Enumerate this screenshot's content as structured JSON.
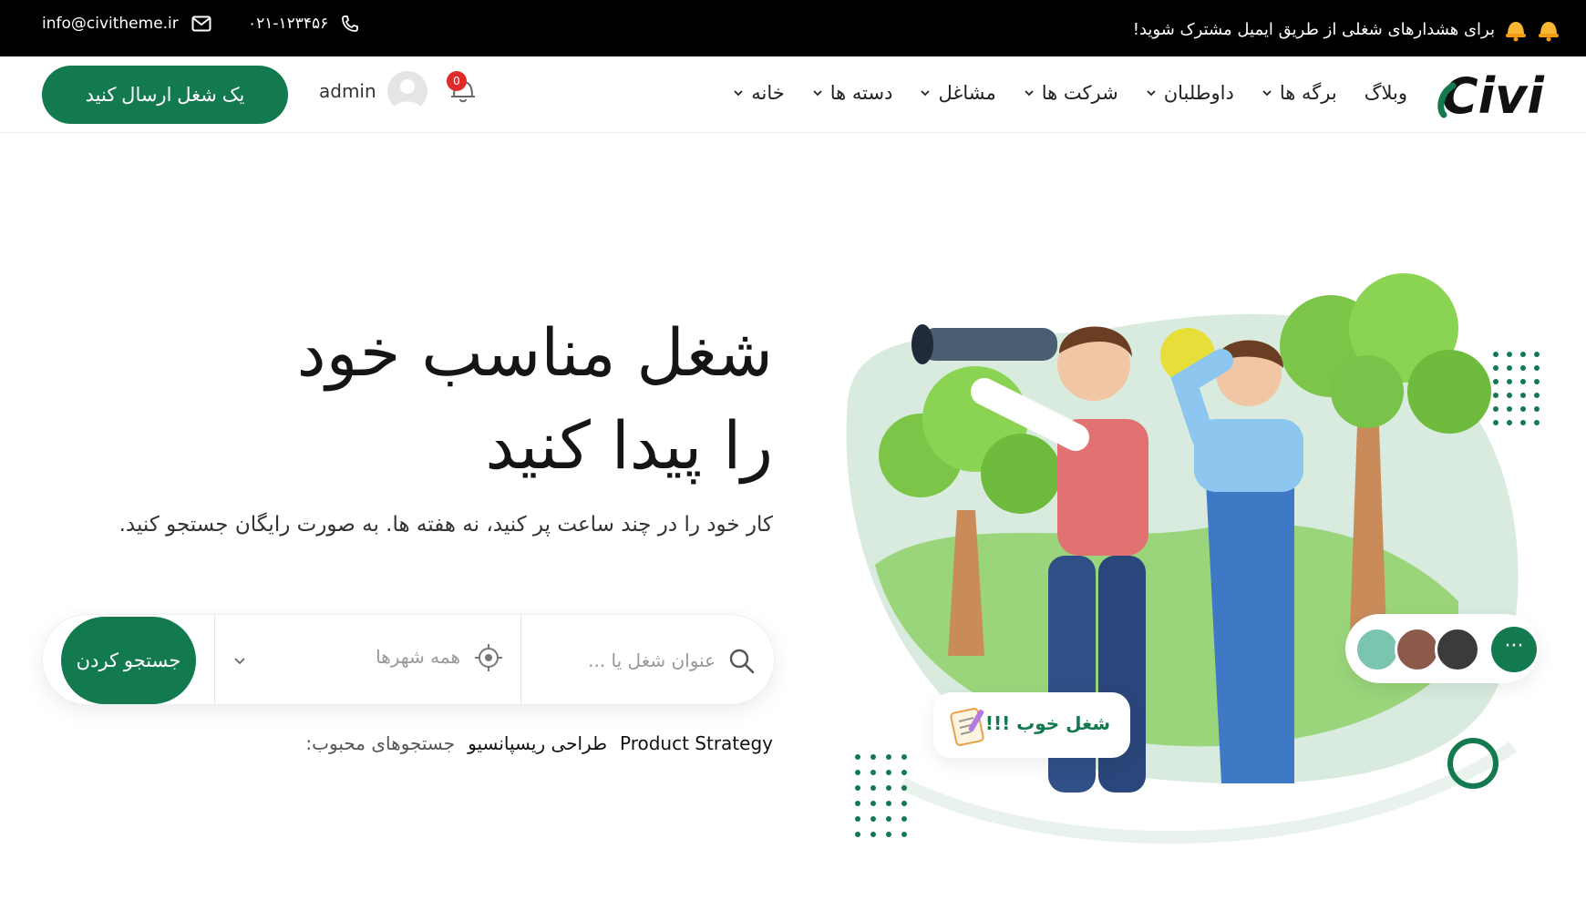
{
  "topbar": {
    "email": "info@civitheme.ir",
    "phone": "۰۲۱-۱۲۳۴۵۶",
    "promo": "برای هشدارهای شغلی از طریق ایمیل مشترک شوید!"
  },
  "header": {
    "logo": "Civi",
    "nav": [
      {
        "label": "خانه"
      },
      {
        "label": "دسته ها"
      },
      {
        "label": "مشاغل"
      },
      {
        "label": "شرکت ها"
      },
      {
        "label": "داوطلبان"
      },
      {
        "label": "برگه ها"
      },
      {
        "label": "وبلاگ"
      }
    ],
    "notification_count": "0",
    "username": "admin",
    "post_job_label": "یک شغل ارسال کنید"
  },
  "hero": {
    "title_line1": "شغل مناسب خود",
    "title_line2": "را پیدا کنید",
    "subtitle": "کار خود را در چند ساعت پر کنید، نه هفته ها. به صورت رایگان جستجو کنید."
  },
  "search": {
    "keyword_placeholder": "عنوان شغل یا ...",
    "city_label": "همه شهرها",
    "button_label": "جستجو کردن"
  },
  "popular": {
    "label": "جستجوهای محبوب:",
    "tags": [
      "طراحی ریسپانسیو",
      "Product Strategy"
    ]
  },
  "illustration": {
    "job_chip_text": "شغل خوب !!!",
    "more_label": "···"
  },
  "colors": {
    "brand": "#137a4f",
    "topbar_bg": "#000000",
    "badge": "#e02b2b",
    "blob": "#d8ebde"
  },
  "icons": [
    "envelope-icon",
    "phone-icon",
    "bell-emoji-icon",
    "chevron-down-icon",
    "notification-bell-icon",
    "avatar-icon",
    "search-icon",
    "target-icon",
    "clipboard-icon"
  ]
}
